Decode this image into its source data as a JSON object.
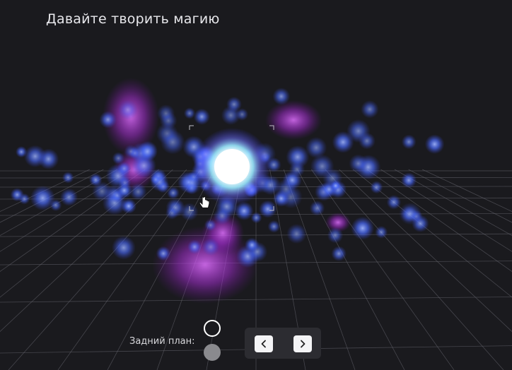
{
  "page": {
    "title": "Давайте творить магию"
  },
  "scene": {
    "icon": "magic-orb-particles",
    "colors": {
      "background": "#1a1a1e",
      "grid": "#6a6a72",
      "particle_blue": "#4a6bff",
      "particle_magenta": "#c23cf0",
      "orb_core": "#ffffff"
    }
  },
  "background_control": {
    "label": "Задний план:",
    "options": [
      {
        "name": "dark",
        "color": "#1a1a1e",
        "selected": true
      },
      {
        "name": "grey",
        "color": "#8a8a8e",
        "selected": false
      }
    ]
  },
  "navigation": {
    "prev_icon": "chevron-left-icon",
    "next_icon": "chevron-right-icon"
  }
}
